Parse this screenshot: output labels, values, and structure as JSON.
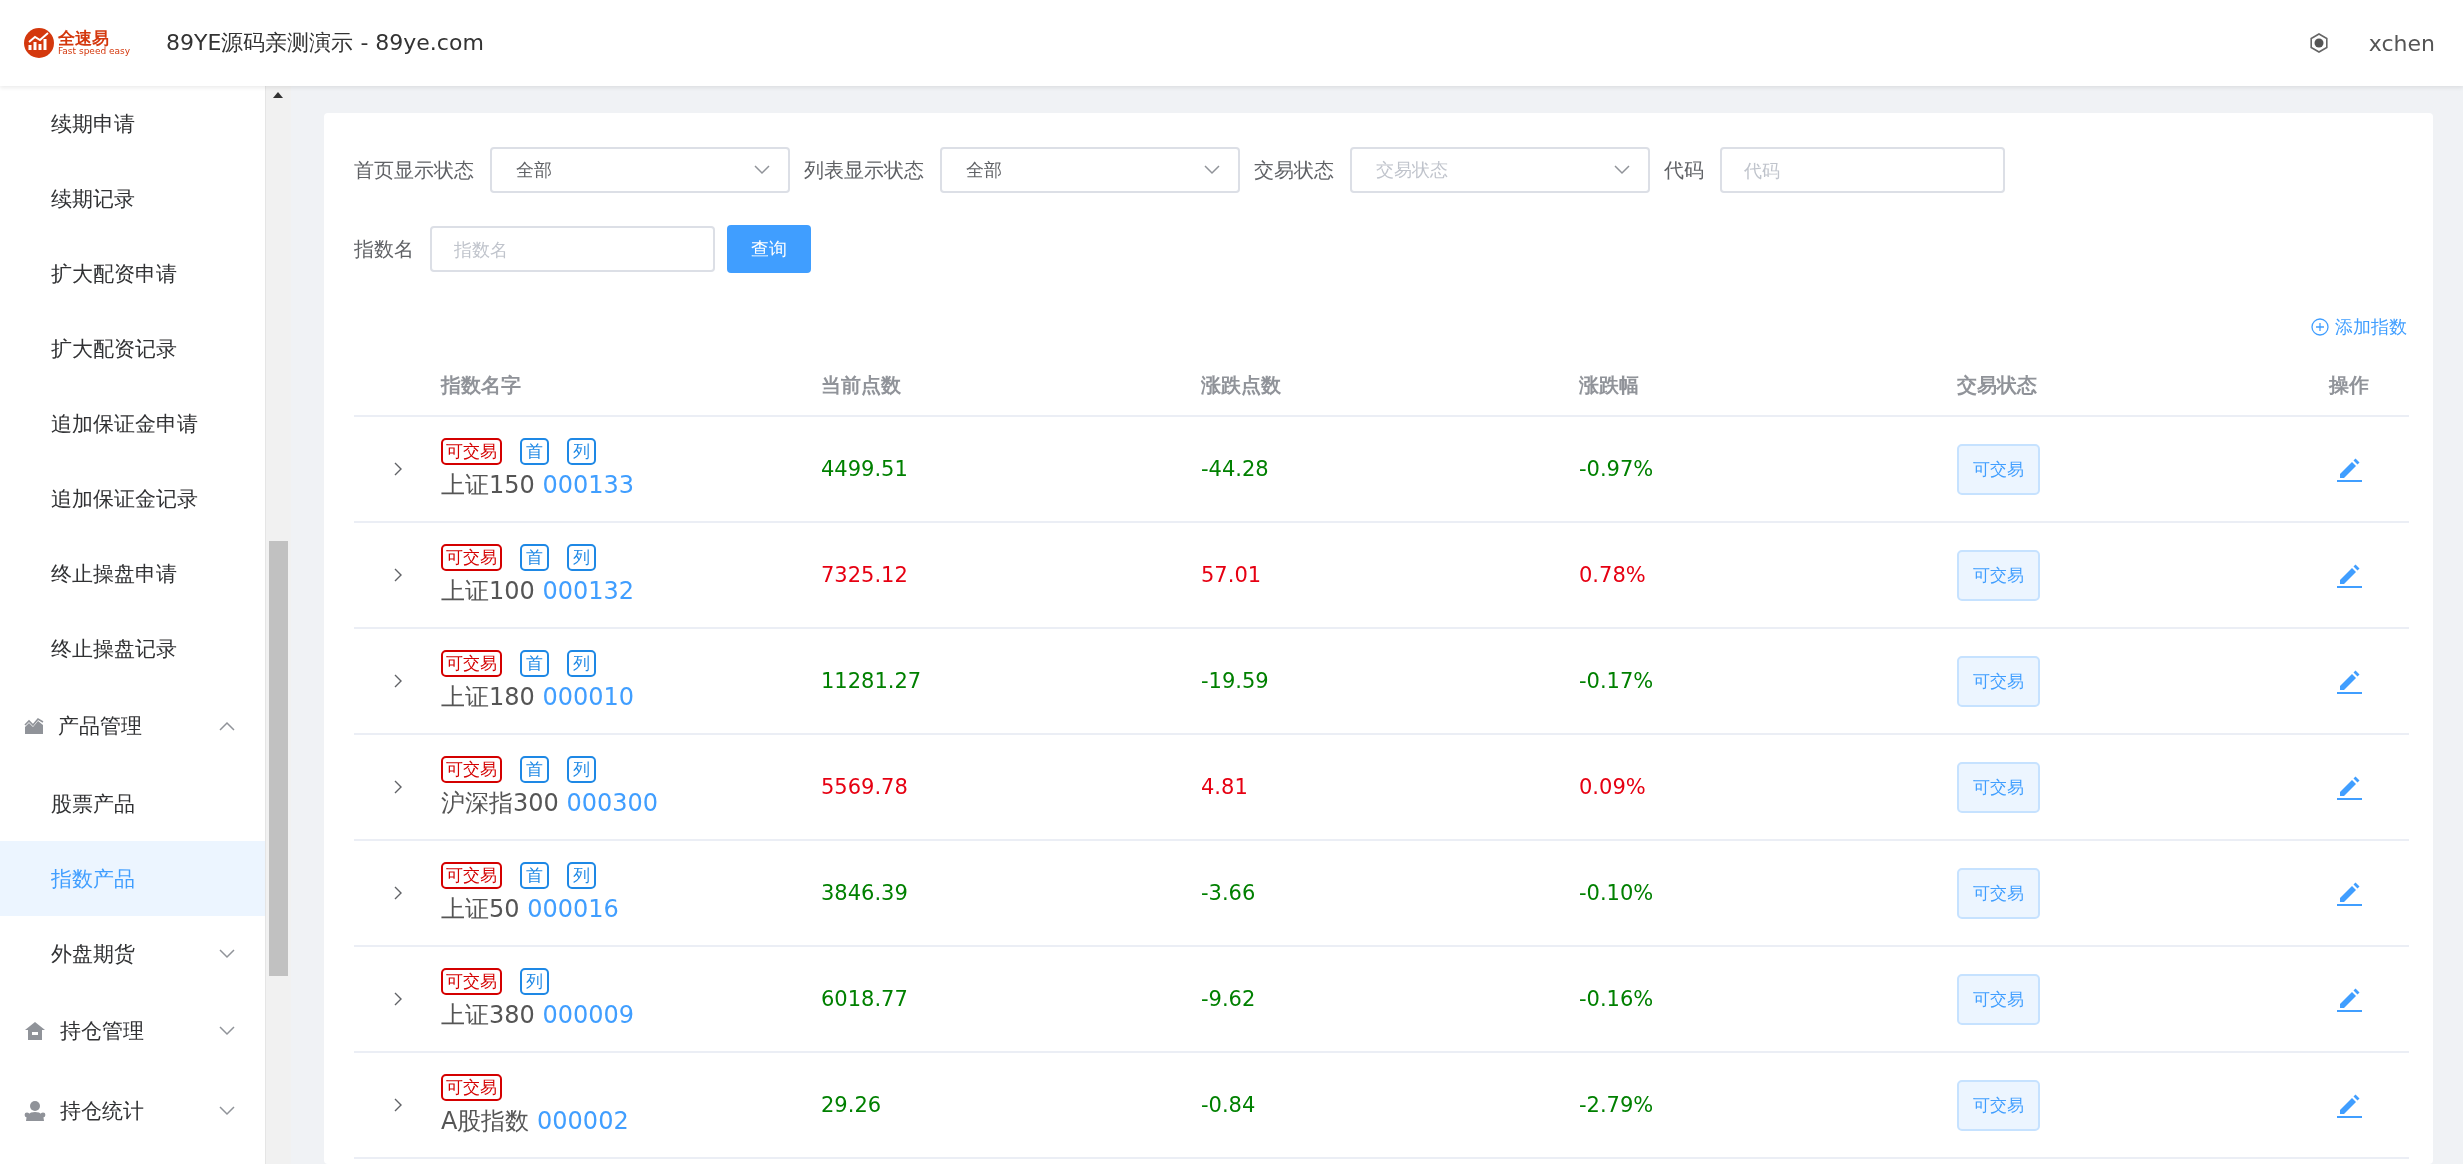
{
  "header": {
    "logo_text": "全速易",
    "logo_subtext": "Fast speed easy",
    "title": "89YE源码亲测演示 - 89ye.com",
    "user": "xchen"
  },
  "sidebar": {
    "items": [
      {
        "label": "续期申请",
        "kind": "link",
        "selected": false
      },
      {
        "label": "续期记录",
        "kind": "link",
        "selected": false
      },
      {
        "label": "扩大配资申请",
        "kind": "link",
        "selected": false
      },
      {
        "label": "扩大配资记录",
        "kind": "link",
        "selected": false
      },
      {
        "label": "追加保证金申请",
        "kind": "link",
        "selected": false
      },
      {
        "label": "追加保证金记录",
        "kind": "link",
        "selected": false
      },
      {
        "label": "终止操盘申请",
        "kind": "link",
        "selected": false
      },
      {
        "label": "终止操盘记录",
        "kind": "link",
        "selected": false
      },
      {
        "label": "产品管理",
        "kind": "group",
        "expanded": true,
        "children": [
          {
            "label": "股票产品",
            "kind": "link",
            "selected": false
          },
          {
            "label": "指数产品",
            "kind": "link",
            "selected": true
          },
          {
            "label": "外盘期货",
            "kind": "subgroup",
            "expanded": false
          }
        ]
      },
      {
        "label": "持仓管理",
        "kind": "group",
        "expanded": false
      },
      {
        "label": "持仓统计",
        "kind": "group",
        "expanded": false
      }
    ]
  },
  "filters": [
    {
      "label": "首页显示状态",
      "kind": "select",
      "value": "全部"
    },
    {
      "label": "列表显示状态",
      "kind": "select",
      "value": "全部"
    },
    {
      "label": "交易状态",
      "kind": "select",
      "placeholder": "交易状态"
    },
    {
      "label": "代码",
      "kind": "input",
      "placeholder": "代码"
    },
    {
      "label": "指数名",
      "kind": "input",
      "placeholder": "指数名"
    }
  ],
  "search_button": "查询",
  "add_link": "添加指数",
  "table": {
    "columns": [
      "指数名字",
      "当前点数",
      "涨跌点数",
      "涨跌幅",
      "交易状态",
      "操作"
    ],
    "rows": [
      {
        "tags": [
          {
            "text": "可交易",
            "kind": "trade"
          },
          {
            "text": "首",
            "kind": "flag"
          },
          {
            "text": "列",
            "kind": "flag"
          }
        ],
        "name": "上证150",
        "code": "000133",
        "current": "4499.51",
        "change": "-44.28",
        "pct": "-0.97%",
        "color": "#008000",
        "status": "可交易"
      },
      {
        "tags": [
          {
            "text": "可交易",
            "kind": "trade"
          },
          {
            "text": "首",
            "kind": "flag"
          },
          {
            "text": "列",
            "kind": "flag"
          }
        ],
        "name": "上证100",
        "code": "000132",
        "current": "7325.12",
        "change": "57.01",
        "pct": "0.78%",
        "color": "#e60012",
        "status": "可交易"
      },
      {
        "tags": [
          {
            "text": "可交易",
            "kind": "trade"
          },
          {
            "text": "首",
            "kind": "flag"
          },
          {
            "text": "列",
            "kind": "flag"
          }
        ],
        "name": "上证180",
        "code": "000010",
        "current": "11281.27",
        "change": "-19.59",
        "pct": "-0.17%",
        "color": "#008000",
        "status": "可交易"
      },
      {
        "tags": [
          {
            "text": "可交易",
            "kind": "trade"
          },
          {
            "text": "首",
            "kind": "flag"
          },
          {
            "text": "列",
            "kind": "flag"
          }
        ],
        "name": "沪深指300",
        "code": "000300",
        "current": "5569.78",
        "change": "4.81",
        "pct": "0.09%",
        "color": "#e60012",
        "status": "可交易"
      },
      {
        "tags": [
          {
            "text": "可交易",
            "kind": "trade"
          },
          {
            "text": "首",
            "kind": "flag"
          },
          {
            "text": "列",
            "kind": "flag"
          }
        ],
        "name": "上证50",
        "code": "000016",
        "current": "3846.39",
        "change": "-3.66",
        "pct": "-0.10%",
        "color": "#008000",
        "status": "可交易"
      },
      {
        "tags": [
          {
            "text": "可交易",
            "kind": "trade"
          },
          {
            "text": "列",
            "kind": "flag"
          }
        ],
        "name": "上证380",
        "code": "000009",
        "current": "6018.77",
        "change": "-9.62",
        "pct": "-0.16%",
        "color": "#008000",
        "status": "可交易"
      },
      {
        "tags": [
          {
            "text": "可交易",
            "kind": "trade"
          }
        ],
        "name": "A股指数",
        "code": "000002",
        "current": "29.26",
        "change": "-0.84",
        "pct": "-2.79%",
        "color": "#008000",
        "status": "可交易"
      }
    ]
  }
}
